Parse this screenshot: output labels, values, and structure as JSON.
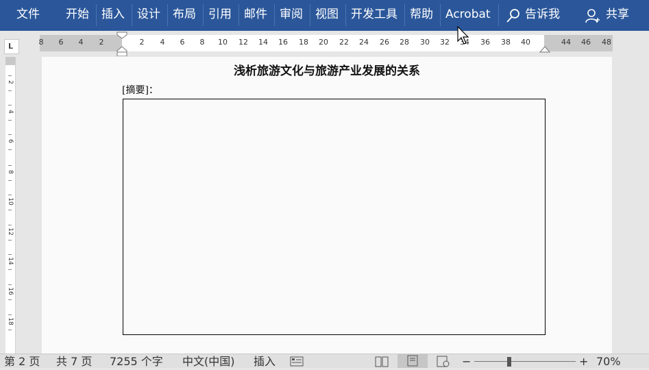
{
  "ribbon": {
    "tabs": [
      "文件",
      "开始",
      "插入",
      "设计",
      "布局",
      "引用",
      "邮件",
      "审阅",
      "视图",
      "开发工具",
      "帮助",
      "Acrobat"
    ],
    "tell_me": "告诉我",
    "share": "共享"
  },
  "ruler": {
    "h_labels": [
      "8",
      "6",
      "4",
      "2",
      "2",
      "4",
      "6",
      "8",
      "10",
      "12",
      "14",
      "16",
      "18",
      "20",
      "22",
      "24",
      "26",
      "28",
      "30",
      "32",
      "34",
      "36",
      "38",
      "40",
      "44",
      "46",
      "48"
    ],
    "v_labels": [
      "2",
      "4",
      "6",
      "8",
      "10",
      "12",
      "14",
      "16",
      "18"
    ],
    "tab_selector": "L"
  },
  "document": {
    "title": "浅析旅游文化与旅游产业发展的关系",
    "abstract_label": "[摘要]："
  },
  "statusbar": {
    "page": "第 2 页",
    "total_pages": "共 7 页",
    "word_count": "7255 个字",
    "language": "中文(中国)",
    "mode": "插入",
    "zoom": "70%"
  }
}
